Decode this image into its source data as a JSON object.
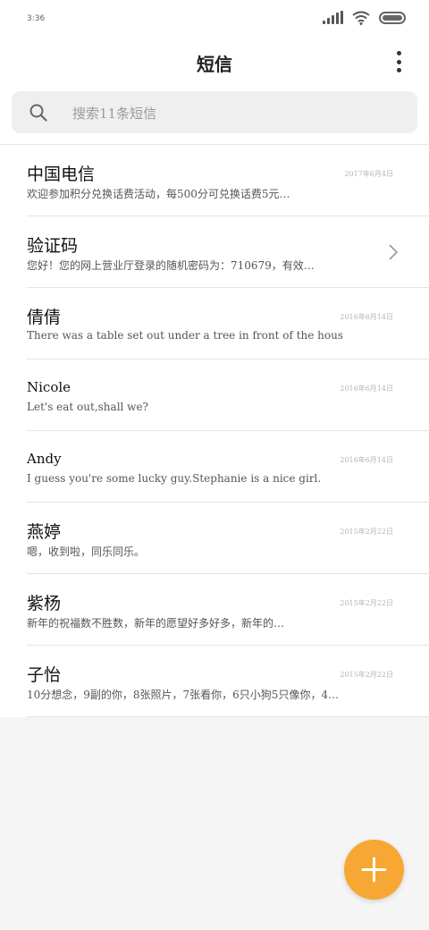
{
  "status_bar": {
    "time": "3:36"
  },
  "header": {
    "title": "短信"
  },
  "search": {
    "placeholder": "搜索11条短信"
  },
  "messages": [
    {
      "name": "中国电信",
      "date": "2017年6月4日",
      "preview": "欢迎参加积分兑换话费活动，每500分可兑换话费5元…"
    },
    {
      "name": "验证码",
      "date": "",
      "preview": "您好！您的网上营业厅登录的随机密码为：710679，有效…"
    },
    {
      "name": "倩倩",
      "date": "2016年6月14日",
      "preview": "There was a table set out under a tree in front of the hous"
    },
    {
      "name": "Nicole",
      "date": "2016年6月14日",
      "preview": "Let's eat out,shall we?"
    },
    {
      "name": "Andy",
      "date": "2016年6月14日",
      "preview": "I guess you're some lucky guy.Stephanie is a nice girl."
    },
    {
      "name": "燕婷",
      "date": "2015年2月22日",
      "preview": "嗯，收到啦，同乐同乐。"
    },
    {
      "name": "紫杨",
      "date": "2015年2月22日",
      "preview": "新年的祝福数不胜数，新年的愿望好多好多，新年的…"
    },
    {
      "name": "子怡",
      "date": "2015年2月22日",
      "preview": "10分想念，9副的你，8张照片，7张看你，6只小狗5只像你，4…"
    }
  ],
  "colors": {
    "accent": "#f7a733",
    "background": "#f5f5f5"
  }
}
